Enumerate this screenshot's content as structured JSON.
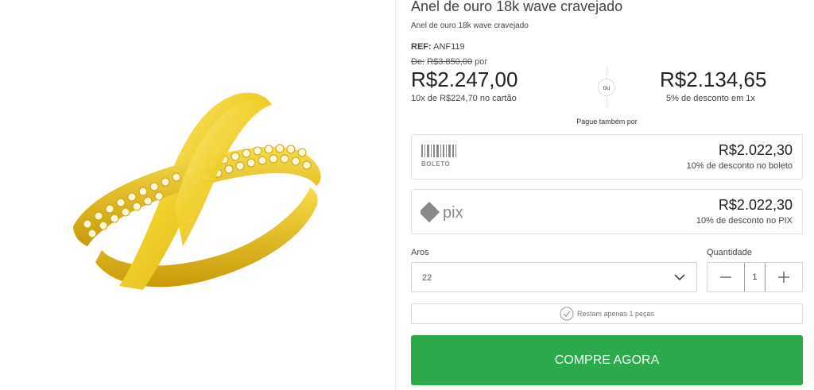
{
  "product": {
    "title": "Anel de ouro 18k wave cravejado",
    "subtitle": "Anel de ouro 18k wave cravejado",
    "ref_label": "REF:",
    "ref_value": "ANF119"
  },
  "pricing": {
    "old_prefix": "De:",
    "old_price": "R$3.850,00",
    "old_suffix": "por",
    "price": "R$2.247,00",
    "installments": "10x de R$224,70 no cartão",
    "or_label": "ou",
    "alt_price": "R$2.134,65",
    "alt_desc": "5% de desconto em 1x",
    "also_pay": "Pague também por"
  },
  "payment_options": [
    {
      "method": "boleto",
      "logo_text": "BOLETO",
      "price": "R$2.022,30",
      "desc": "10% de desconto no boleto"
    },
    {
      "method": "pix",
      "logo_text": "pix",
      "price": "R$2.022,30",
      "desc": "10% de desconto no PIX"
    }
  ],
  "options": {
    "aros_label": "Aros",
    "aros_value": "22",
    "qty_label": "Quantidade",
    "qty_value": "1"
  },
  "stock": {
    "text": "Restam apenas 1 peças"
  },
  "buy_button": {
    "label": "COMPRE AGORA"
  },
  "icons": {
    "select": "chevron-down-icon",
    "decrease": "minus-icon",
    "increase": "plus-icon",
    "stock": "check-circle-icon"
  },
  "colors": {
    "buy_button": "#2aaa4a",
    "gold": "#e8c21c",
    "logo_grey": "#8a8a8a"
  }
}
